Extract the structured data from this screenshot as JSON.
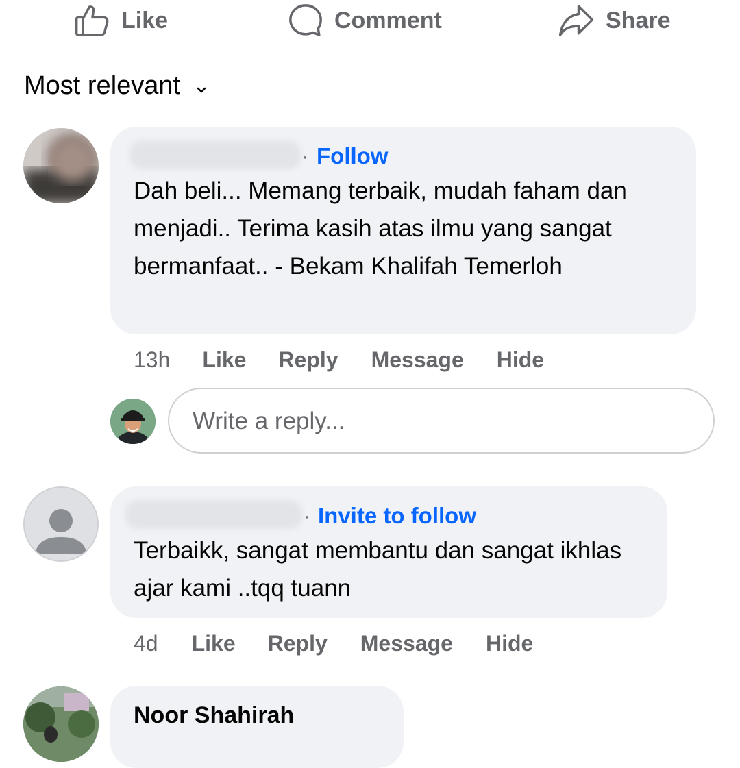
{
  "actions": {
    "like_label": "Like",
    "comment_label": "Comment",
    "share_label": "Share"
  },
  "sort": {
    "label": "Most relevant"
  },
  "comments": [
    {
      "follow_label": "Follow",
      "text": "Dah beli... Memang terbaik, mudah faham dan menjadi.. Terima kasih atas ilmu yang sangat bermanfaat.. - Bekam Khalifah Temerloh",
      "time": "13h",
      "like_label": "Like",
      "reply_label": "Reply",
      "message_label": "Message",
      "hide_label": "Hide"
    },
    {
      "follow_label": "Invite to follow",
      "text": "Terbaikk, sangat membantu dan sangat ikhlas ajar kami ..tqq tuann",
      "time": "4d",
      "like_label": "Like",
      "reply_label": "Reply",
      "message_label": "Message",
      "hide_label": "Hide"
    },
    {
      "author": "Noor Shahirah"
    }
  ],
  "reply_input": {
    "placeholder": "Write a reply..."
  },
  "colors": {
    "link_blue": "#0866ff",
    "secondary_text": "#65676b",
    "bubble_bg": "#f0f2f5"
  }
}
